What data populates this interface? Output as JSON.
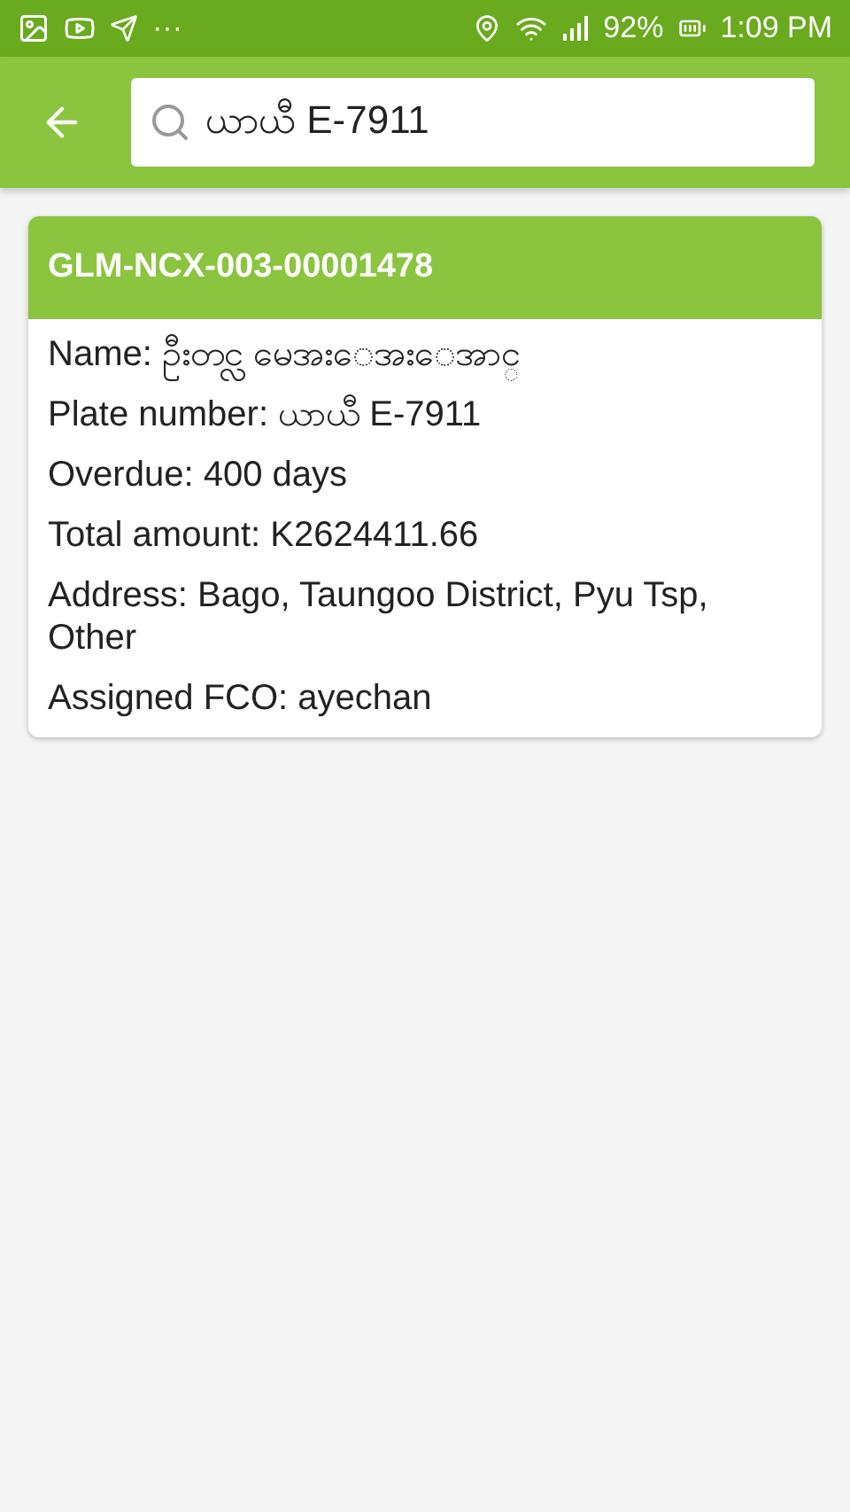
{
  "status_bar": {
    "more": "···",
    "battery": "92%",
    "time": "1:09 PM"
  },
  "search": {
    "value": "ယာယီ E-7911"
  },
  "results": [
    {
      "title": "GLM-NCX-003-00001478",
      "fields": [
        {
          "label": "Name:",
          "value": "ဦးတင္လ မေအးေအးေအာင္"
        },
        {
          "label": "Plate number:",
          "value": "ယာယီ E-7911"
        },
        {
          "label": "Overdue:",
          "value": "400 days"
        },
        {
          "label": "Total amount:",
          "value": "K2624411.66"
        },
        {
          "label": "Address:",
          "value": "Bago, Taungoo District, Pyu Tsp, Other"
        },
        {
          "label": "Assigned FCO:",
          "value": "ayechan"
        }
      ]
    }
  ]
}
